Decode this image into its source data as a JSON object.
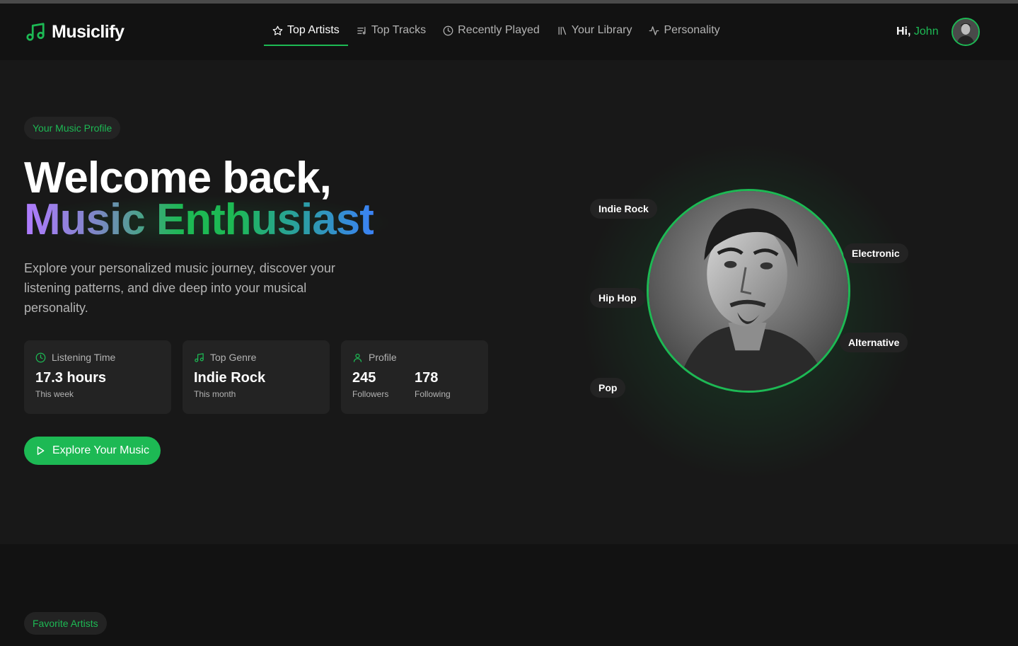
{
  "app": {
    "name": "Musiclify"
  },
  "nav": {
    "items": [
      {
        "label": "Top Artists",
        "icon": "star-icon",
        "active": true
      },
      {
        "label": "Top Tracks",
        "icon": "playlist-icon",
        "active": false
      },
      {
        "label": "Recently Played",
        "icon": "clock-icon",
        "active": false
      },
      {
        "label": "Your Library",
        "icon": "library-icon",
        "active": false
      },
      {
        "label": "Personality",
        "icon": "activity-icon",
        "active": false
      }
    ]
  },
  "user": {
    "greeting": "Hi,",
    "name": "John"
  },
  "hero": {
    "badge": "Your Music Profile",
    "title_line1": "Welcome back,",
    "title_line2": "Music Enthusiast",
    "description": "Explore your personalized music journey, discover your listening patterns, and dive deep into your musical personality.",
    "cards": {
      "listening": {
        "label": "Listening Time",
        "value": "17.3 hours",
        "caption": "This week"
      },
      "genre": {
        "label": "Top Genre",
        "value": "Indie Rock",
        "caption": "This month"
      },
      "profile": {
        "label": "Profile",
        "followers_value": "245",
        "followers_label": "Followers",
        "following_value": "178",
        "following_label": "Following"
      }
    },
    "cta": "Explore Your Music",
    "genres": [
      "Indie Rock",
      "Electronic",
      "Hip Hop",
      "Alternative",
      "Pop"
    ]
  },
  "sections": {
    "favorite_artists": "Favorite Artists"
  },
  "colors": {
    "accent": "#1db954",
    "background": "#121212",
    "surface": "#181818",
    "card": "#232323",
    "muted_text": "#b3b3b3"
  }
}
